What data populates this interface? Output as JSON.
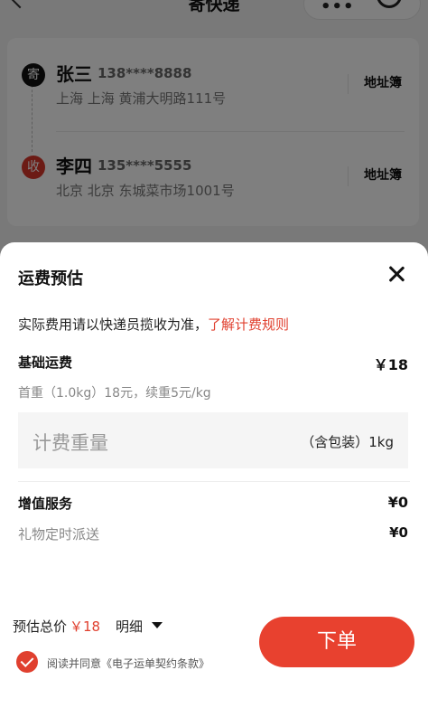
{
  "nav": {
    "title": "寄快递",
    "capsule_dots": "•••"
  },
  "sender": {
    "badge": "寄",
    "name": "张三",
    "phone": "138****8888",
    "address": "上海 上海 黄浦大明路111号",
    "book_label": "地址簿"
  },
  "receiver": {
    "badge": "收",
    "name": "李四",
    "phone": "135****5555",
    "address": "北京 北京 东城菜市场1001号",
    "book_label": "地址簿"
  },
  "sheet": {
    "title": "运费预估",
    "note_text": "实际费用请以快递员揽收为准，",
    "note_link": "了解计费规则",
    "base_fee_label": "基础运费",
    "base_fee_value": "￥18",
    "base_fee_detail": "首重（1.0kg）18元，续重5元/kg",
    "weight_placeholder": "计费重量",
    "weight_suffix": "（含包装）1kg",
    "value_added_label": "增值服务",
    "value_added_value": "¥0",
    "gift_label": "礼物定时派送",
    "gift_value": "¥0"
  },
  "footer": {
    "total_label": "预估总价",
    "total_price": "￥18",
    "detail_label": "明细",
    "agreement_text": "阅读并同意《电子运单契约条款》",
    "order_button": "下单"
  },
  "colors": {
    "accent": "#e8412f",
    "link": "#e0402f"
  }
}
